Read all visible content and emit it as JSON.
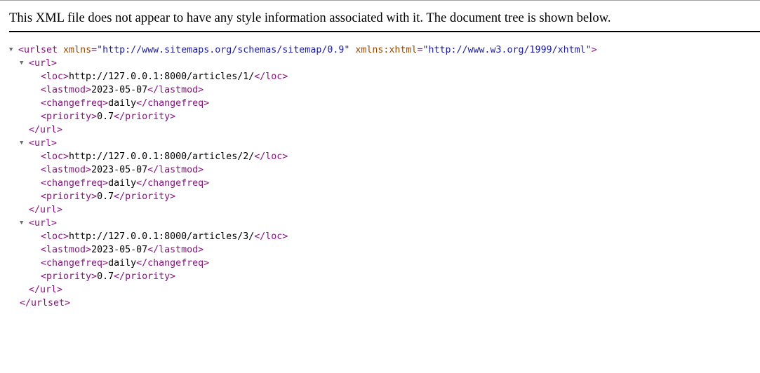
{
  "header": {
    "message": "This XML file does not appear to have any style information associated with it. The document tree is shown below."
  },
  "icons": {
    "collapse": "triangle-down-icon"
  },
  "colors": {
    "tag": "#881280",
    "attr_name": "#994500",
    "attr_value": "#1a1aa6",
    "text": "#000000",
    "triangle": "#6e6e6e"
  },
  "tree": {
    "root_open_prefix": "<urlset",
    "attr1_name": " xmlns",
    "attr_eq": "=",
    "attr1_value": "\"http://www.sitemaps.org/schemas/sitemap/0.9\"",
    "attr2_name": " xmlns:xhtml",
    "attr2_value": "\"http://www.w3.org/1999/xhtml\"",
    "root_open_suffix": ">",
    "root_close": "</urlset>",
    "url_open": "<url>",
    "url_close": "</url>",
    "urls": [
      {
        "loc_open": "<loc>",
        "loc": "http://127.0.0.1:8000/articles/1/",
        "loc_close": "</loc>",
        "lastmod_open": "<lastmod>",
        "lastmod": "2023-05-07",
        "lastmod_close": "</lastmod>",
        "changefreq_open": "<changefreq>",
        "changefreq": "daily",
        "changefreq_close": "</changefreq>",
        "priority_open": "<priority>",
        "priority": "0.7",
        "priority_close": "</priority>"
      },
      {
        "loc_open": "<loc>",
        "loc": "http://127.0.0.1:8000/articles/2/",
        "loc_close": "</loc>",
        "lastmod_open": "<lastmod>",
        "lastmod": "2023-05-07",
        "lastmod_close": "</lastmod>",
        "changefreq_open": "<changefreq>",
        "changefreq": "daily",
        "changefreq_close": "</changefreq>",
        "priority_open": "<priority>",
        "priority": "0.7",
        "priority_close": "</priority>"
      },
      {
        "loc_open": "<loc>",
        "loc": "http://127.0.0.1:8000/articles/3/",
        "loc_close": "</loc>",
        "lastmod_open": "<lastmod>",
        "lastmod": "2023-05-07",
        "lastmod_close": "</lastmod>",
        "changefreq_open": "<changefreq>",
        "changefreq": "daily",
        "changefreq_close": "</changefreq>",
        "priority_open": "<priority>",
        "priority": "0.7",
        "priority_close": "</priority>"
      }
    ]
  }
}
